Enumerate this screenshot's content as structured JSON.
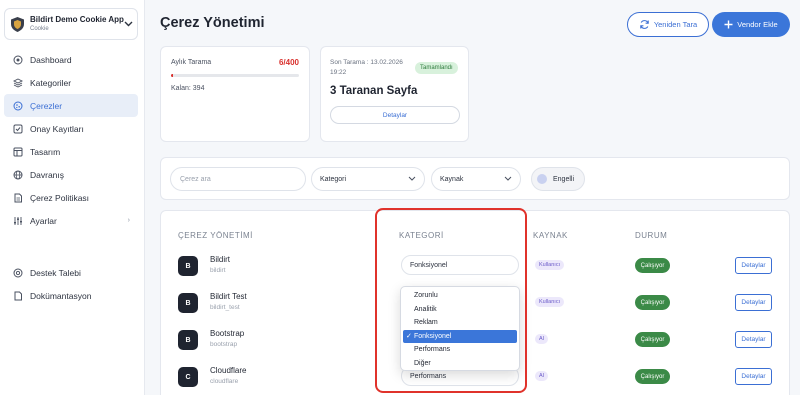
{
  "app": {
    "name": "Bildirt Demo Cookie App",
    "subtitle": "Cookie"
  },
  "sidebar": {
    "items": [
      {
        "label": "Dashboard",
        "icon": "dashboard-icon"
      },
      {
        "label": "Kategoriler",
        "icon": "layers-icon"
      },
      {
        "label": "Çerezler",
        "icon": "cookie-icon",
        "active": true
      },
      {
        "label": "Onay Kayıtları",
        "icon": "checkbox-icon"
      },
      {
        "label": "Tasarım",
        "icon": "layout-icon"
      },
      {
        "label": "Davranış",
        "icon": "globe-icon"
      },
      {
        "label": "Çerez Politikası",
        "icon": "document-icon"
      },
      {
        "label": "Ayarlar",
        "icon": "sliders-icon"
      }
    ],
    "bottom_items": [
      {
        "label": "Destek Talebi",
        "icon": "help-icon"
      },
      {
        "label": "Dokümantasyon",
        "icon": "doc-icon"
      }
    ]
  },
  "header": {
    "title": "Çerez Yönetimi",
    "rescan_label": "Yeniden Tara",
    "add_vendor_label": "Vendor Ekle"
  },
  "scan_card": {
    "label": "Aylık Tarama",
    "value": "6/400",
    "progress": 0.015,
    "remaining": "Kalan: 394"
  },
  "last_scan_card": {
    "label": "Son Tarama : 13.02.2026 19:22",
    "badge": "Tamamlandı",
    "title": "3 Taranan Sayfa",
    "details_label": "Detaylar"
  },
  "filters": {
    "search_placeholder": "Çerez ara",
    "category_label": "Kategori",
    "source_label": "Kaynak",
    "blocked_label": "Engelli"
  },
  "table": {
    "headers": {
      "name": "ÇEREZ YÖNETİMİ",
      "category": "KATEGORİ",
      "source": "KAYNAK",
      "status": "DURUM"
    },
    "rows": [
      {
        "initial": "B",
        "name": "Bildirt",
        "sub": "bildirt",
        "category": "Fonksiyonel",
        "source": "Kullanıcı",
        "status": "Çalışıyor",
        "action": "Detaylar"
      },
      {
        "initial": "B",
        "name": "Bildirt Test",
        "sub": "bildirt_test",
        "category": "",
        "source": "Kullanıcı",
        "status": "Çalışıyor",
        "action": "Detaylar"
      },
      {
        "initial": "B",
        "name": "Bootstrap",
        "sub": "bootstrap",
        "category": "",
        "source": "AI",
        "status": "Çalışıyor",
        "action": "Detaylar"
      },
      {
        "initial": "C",
        "name": "Cloudflare",
        "sub": "cloudflare",
        "category": "Performans",
        "source": "AI",
        "status": "Çalışıyor",
        "action": "Detaylar"
      }
    ]
  },
  "category_dropdown": {
    "options": [
      "Zorunlu",
      "Analitik",
      "Reklam",
      "Fonksiyonel",
      "Performans",
      "Diğer"
    ],
    "selected": "Fonksiyonel"
  },
  "colors": {
    "accent": "#3b76d9",
    "danger": "#d9312e",
    "success": "#3b8a47",
    "highlight": "#e0322b"
  }
}
